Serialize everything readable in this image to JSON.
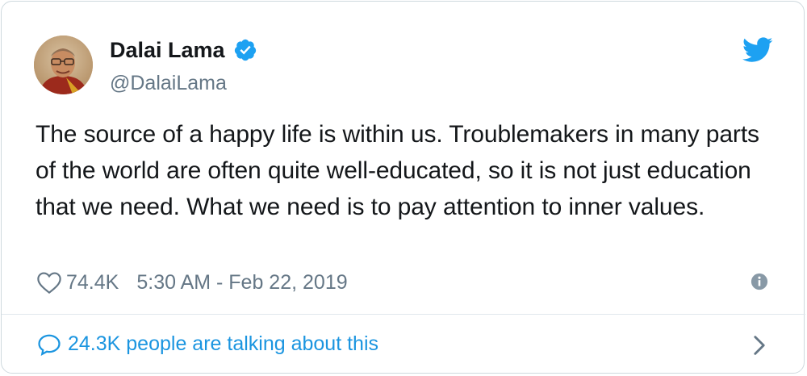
{
  "tweet": {
    "author_name": "Dalai Lama",
    "author_handle": "@DalaiLama",
    "text": "The source of a happy life is within us. Troublemakers in many parts of the world are often quite well-educated, so it is not just education that we need. What we need is to pay attention to inner values.",
    "likes": "74.4K",
    "timestamp": "5:30 AM - Feb 22, 2019",
    "talking": "24.3K people are talking about this"
  },
  "colors": {
    "accent": "#1b95e0",
    "verified": "#1da1f2",
    "text": "#14171a",
    "muted": "#657786",
    "border": "#cfd9de"
  },
  "icons": [
    "avatar",
    "verified-badge-icon",
    "twitter-bird-icon",
    "heart-icon",
    "info-icon",
    "speech-bubble-icon",
    "chevron-right-icon"
  ]
}
